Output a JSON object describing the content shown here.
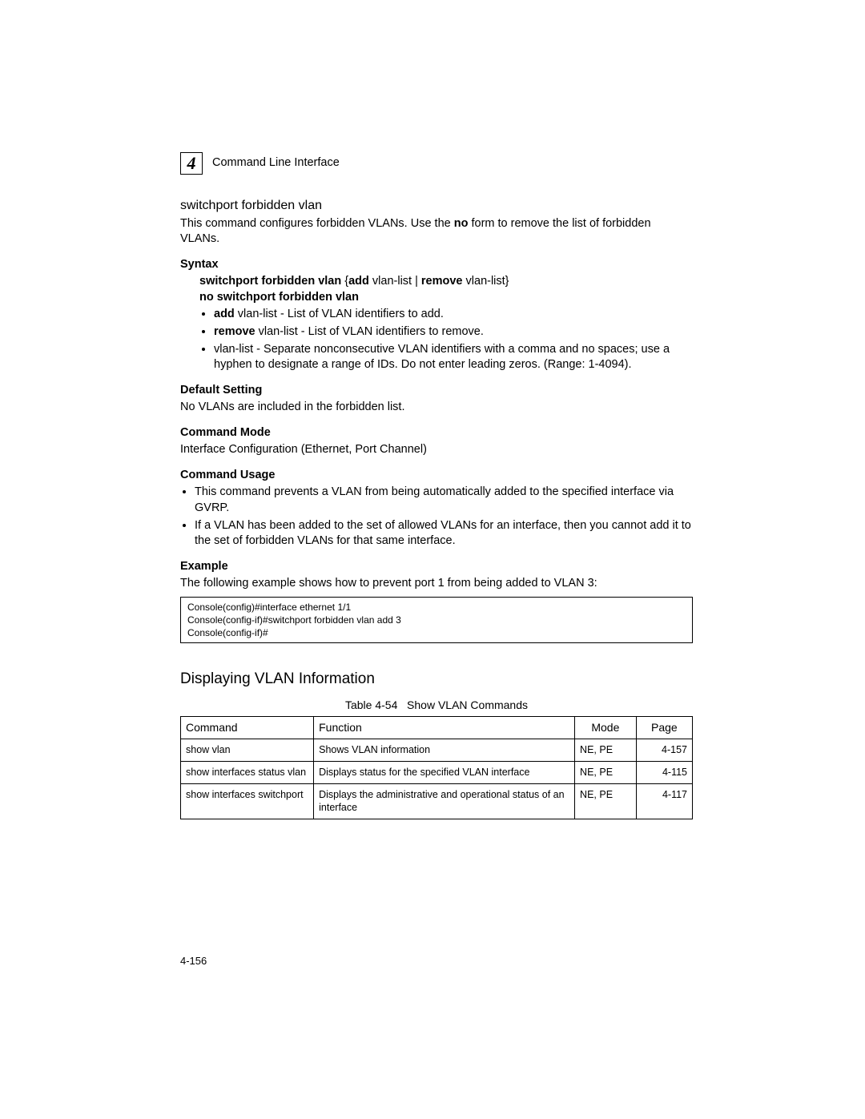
{
  "header": {
    "chapter_number": "4",
    "running_title": "Command Line Interface"
  },
  "command": {
    "title": "switchport forbidden vlan",
    "description_pre": "This command configures forbidden VLANs. Use the ",
    "description_bold": "no",
    "description_post": " form to remove the list of forbidden VLANs."
  },
  "syntax": {
    "heading": "Syntax",
    "b1": "switchport forbidden vlan",
    "t1": " {",
    "b2": "add",
    "t2": " vlan-list | ",
    "b3": "remove",
    "t3": " vlan-list}",
    "line2": "no switchport forbidden vlan",
    "bullets": {
      "a_bold": "add",
      "a_rest": " vlan-list - List of VLAN identifiers to add.",
      "b_bold": "remove",
      "b_rest": " vlan-list - List of VLAN identifiers to remove.",
      "c": "vlan-list - Separate nonconsecutive VLAN identifiers with a comma and no spaces; use a hyphen to designate a range of IDs. Do not enter leading zeros. (Range: 1-4094)."
    }
  },
  "default_setting": {
    "heading": "Default Setting",
    "text": "No VLANs are included in the forbidden list."
  },
  "command_mode": {
    "heading": "Command Mode",
    "text": "Interface Configuration (Ethernet, Port Channel)"
  },
  "command_usage": {
    "heading": "Command Usage",
    "b1": "This command prevents a VLAN from being automatically added to the specified interface via GVRP.",
    "b2": "If a VLAN has been added to the set of allowed VLANs for an interface, then you cannot add it to the set of forbidden VLANs for that same interface."
  },
  "example": {
    "heading": "Example",
    "intro": "The following example shows how to prevent port 1 from being added to VLAN 3:",
    "code": "Console(config)#interface ethernet 1/1\nConsole(config-if)#switchport forbidden vlan add 3\nConsole(config-if)#"
  },
  "section2": {
    "title": "Displaying VLAN Information",
    "table_caption_prefix": "Table 4-54",
    "table_caption_title": "Show VLAN Commands",
    "headers": {
      "c1": "Command",
      "c2": "Function",
      "c3": "Mode",
      "c4": "Page"
    },
    "rows": [
      {
        "c1": "show vlan",
        "c2": "Shows VLAN information",
        "c3": "NE, PE",
        "c4": "4-157"
      },
      {
        "c1": "show interfaces status vlan",
        "c2": "Displays status for the specified VLAN interface",
        "c3": "NE, PE",
        "c4": "4-115"
      },
      {
        "c1": "show interfaces switchport",
        "c2": "Displays the administrative and operational status of an interface",
        "c3": "NE, PE",
        "c4": "4-117"
      }
    ]
  },
  "footer": {
    "page": "4-156"
  }
}
